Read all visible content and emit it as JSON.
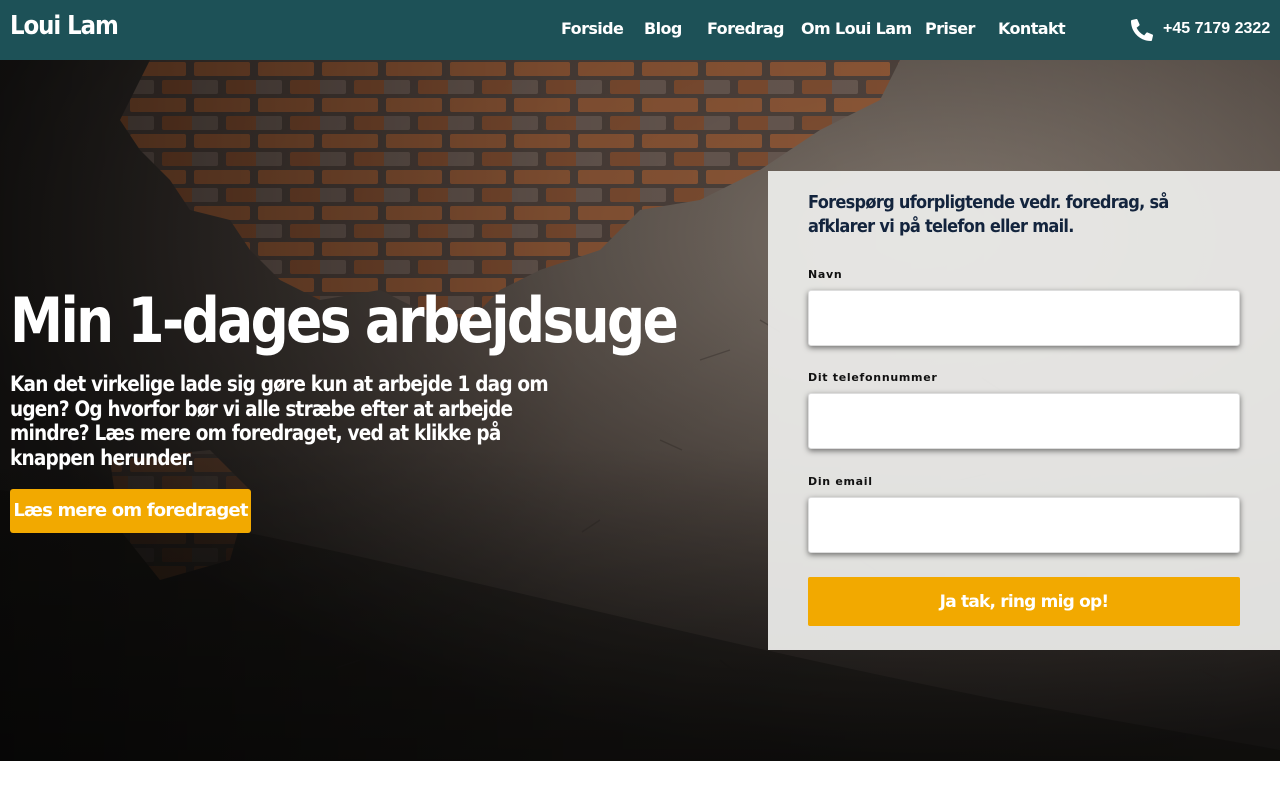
{
  "brand": {
    "name": "Loui Lam"
  },
  "nav": {
    "items": [
      {
        "label": "Forside"
      },
      {
        "label": "Blog"
      },
      {
        "label": "Foredrag"
      },
      {
        "label": "Om Loui Lam"
      },
      {
        "label": "Priser"
      },
      {
        "label": "Kontakt"
      }
    ]
  },
  "contact": {
    "phone": "+45 7179 2322",
    "icon": "phone-icon"
  },
  "hero": {
    "title": "Min 1-dages arbejdsuge",
    "subtitle": "Kan det virkelige lade sig gøre kun at arbejde 1 dag om ugen? Og hvorfor bør vi alle stræbe efter at arbejde mindre? Læs mere om foredraget, ved at klikke på knappen herunder.",
    "cta_label": "Læs mere om foredraget"
  },
  "form": {
    "heading": "Forespørg uforpligtende vedr. foredrag, så afklarer vi på telefon eller mail.",
    "fields": [
      {
        "label": "Navn",
        "value": ""
      },
      {
        "label": "Dit telefonnummer",
        "value": ""
      },
      {
        "label": "Din email",
        "value": ""
      }
    ],
    "submit_label": "Ja tak, ring mig op!"
  },
  "colors": {
    "header_bg": "#1d5157",
    "accent": "#f2a900",
    "text_light": "#ffffff",
    "form_heading": "#13243d"
  }
}
